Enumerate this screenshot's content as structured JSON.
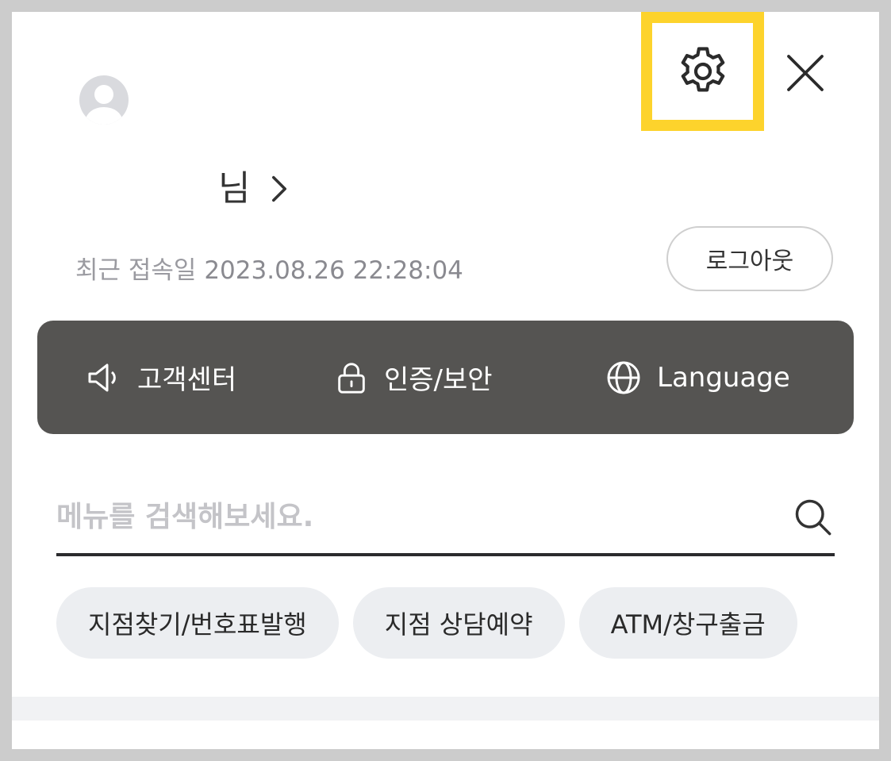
{
  "header": {
    "settings_icon": "gear-icon",
    "close_icon": "close-icon",
    "highlight_color": "#fdd32c"
  },
  "profile": {
    "avatar_icon": "user-avatar-icon",
    "name": "",
    "honorific": "님",
    "chevron_icon": "chevron-right-icon",
    "last_login_label": "최근 접속일",
    "last_login_time": "2023.08.26 22:28:04",
    "logout_label": "로그아웃"
  },
  "quick_menu": {
    "background": "#555452",
    "items": [
      {
        "label": "고객센터",
        "icon": "megaphone-icon"
      },
      {
        "label": "인증/보안",
        "icon": "lock-icon"
      },
      {
        "label": "Language",
        "icon": "globe-icon"
      }
    ]
  },
  "search": {
    "placeholder": "메뉴를 검색해보세요.",
    "value": "",
    "icon": "search-icon"
  },
  "chips": [
    {
      "label": "지점찾기/번호표발행"
    },
    {
      "label": "지점 상담예약"
    },
    {
      "label": "ATM/창구출금"
    }
  ]
}
